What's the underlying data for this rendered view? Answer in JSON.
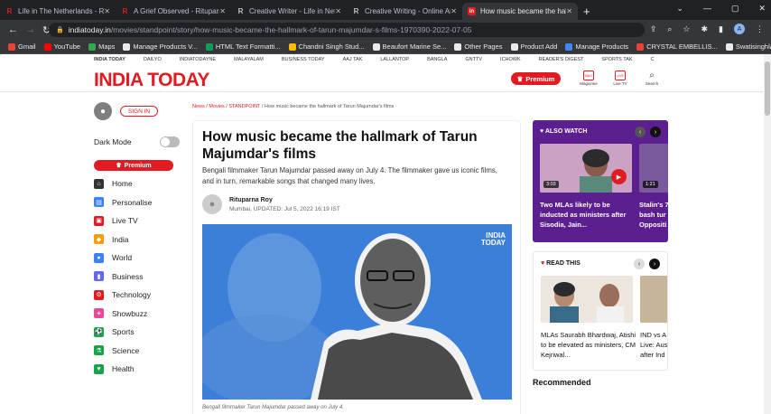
{
  "browser": {
    "tabs": [
      {
        "title": "Life in The Netherlands - Rituparna",
        "favicon": "R",
        "color": "#e11b22"
      },
      {
        "title": "A Grief Observed - Rituparna Roy",
        "favicon": "R",
        "color": "#e11b22"
      },
      {
        "title": "Creative Writer - Life in Netherlands",
        "favicon": "R",
        "color": "#e8eaed"
      },
      {
        "title": "Creative Writing - Online Articles",
        "favicon": "R",
        "color": "#e8eaed"
      },
      {
        "title": "How music became the hallmark",
        "favicon": "in",
        "color": "#e11b22",
        "active": true
      }
    ],
    "url_host": "indiatoday.in",
    "url_path": "/movies/standpoint/story/how-music-became-the-hallmark-of-tarun-majumdar-s-films-1970390-2022-07-05",
    "profile_initial": "A",
    "bookmarks": [
      {
        "label": "Gmail",
        "color": "#ea4335"
      },
      {
        "label": "YouTube",
        "color": "#ff0000"
      },
      {
        "label": "Maps",
        "color": "#34a853"
      },
      {
        "label": "Manage Products V...",
        "color": "#e8eaed"
      },
      {
        "label": "HTML Text Formatti...",
        "color": "#0f9d58"
      },
      {
        "label": "Chandni Singh Stud...",
        "color": "#fbbc04"
      },
      {
        "label": "Beaufort Marine Se...",
        "color": "#e8eaed"
      },
      {
        "label": "Other Pages",
        "color": "#e8eaed"
      },
      {
        "label": "Product Add",
        "color": "#e8eaed"
      },
      {
        "label": "Manage Products",
        "color": "#4285f4"
      },
      {
        "label": "CRYSTAL EMBELLIS...",
        "color": "#ea4335"
      },
      {
        "label": "Swatisinghlabel.com",
        "color": "#e8eaed"
      }
    ]
  },
  "topnav": [
    "INDIA TODAY",
    "DAILYO",
    "INDIATODAYNE",
    "MALAYALAM",
    "BUSINESS TODAY",
    "AAJ TAK",
    "LALLANTOP",
    "BANGLA",
    "GNTTV",
    "ICHOWK",
    "READER'S DIGEST",
    "SPORTS TAK",
    "C"
  ],
  "header": {
    "logo": "INDIA TODAY",
    "premium": "Premium",
    "icons": [
      {
        "label": "Magazine",
        "glyph": "MAG"
      },
      {
        "label": "Live TV",
        "glyph": "LIVE"
      },
      {
        "label": "Search",
        "glyph": "Q"
      }
    ]
  },
  "sidebar": {
    "signin": "SIGN IN",
    "dark_mode": "Dark Mode",
    "premium": "Premium",
    "items": [
      {
        "label": "Home",
        "icon": "home-icon",
        "color": "#333"
      },
      {
        "label": "Personalise",
        "icon": "personalise-icon",
        "color": "#3b82f6"
      },
      {
        "label": "Live TV",
        "icon": "live-tv-icon",
        "color": "#e11b22"
      },
      {
        "label": "India",
        "icon": "india-icon",
        "color": "#f59e0b"
      },
      {
        "label": "World",
        "icon": "world-icon",
        "color": "#3b82f6"
      },
      {
        "label": "Business",
        "icon": "business-icon",
        "color": "#6366f1"
      },
      {
        "label": "Technology",
        "icon": "technology-icon",
        "color": "#e11b22"
      },
      {
        "label": "Showbuzz",
        "icon": "showbuzz-icon",
        "color": "#ec4899"
      },
      {
        "label": "Sports",
        "icon": "sports-icon",
        "color": "#16a34a"
      },
      {
        "label": "Science",
        "icon": "science-icon",
        "color": "#16a34a"
      },
      {
        "label": "Health",
        "icon": "health-icon",
        "color": "#16a34a"
      }
    ]
  },
  "article": {
    "breadcrumb": {
      "news": "News",
      "movies": "Movies",
      "standpoint": "STANDPOINT",
      "current": "How music became the hallmark of Tarun Majumdar's films"
    },
    "title": "How music became the hallmark of Tarun Majumdar's films",
    "description": "Bengali filmmaker Tarun Majumdar passed away on July 4. The filmmaker gave us iconic films, and in turn, remarkable songs that changed many lives.",
    "author": "Rituparna Roy",
    "meta": "Mumbai, UPDATED: Jul 5, 2022 16:19 IST",
    "image_logo_line1": "INDIA",
    "image_logo_line2": "TODAY",
    "caption": "Bengali filmmaker Tarun Majumdar passed away on July 4."
  },
  "also_watch": {
    "heading": "ALSO WATCH",
    "videos": [
      {
        "duration": "3:03",
        "caption": "Two MLAs likely to be inducted as ministers after Sisodia, Jain..."
      },
      {
        "duration": "1:21",
        "caption": "Stalin's 7 bash tur Oppositi"
      }
    ]
  },
  "read_this": {
    "heading": "READ THIS",
    "items": [
      {
        "caption": "MLAs Saurabh Bhardwaj, Atishi to be elevated as ministers, CM Kejriwal..."
      },
      {
        "caption": "IND vs A Live: Aus after Ind"
      }
    ]
  },
  "recommended": "Recommended"
}
